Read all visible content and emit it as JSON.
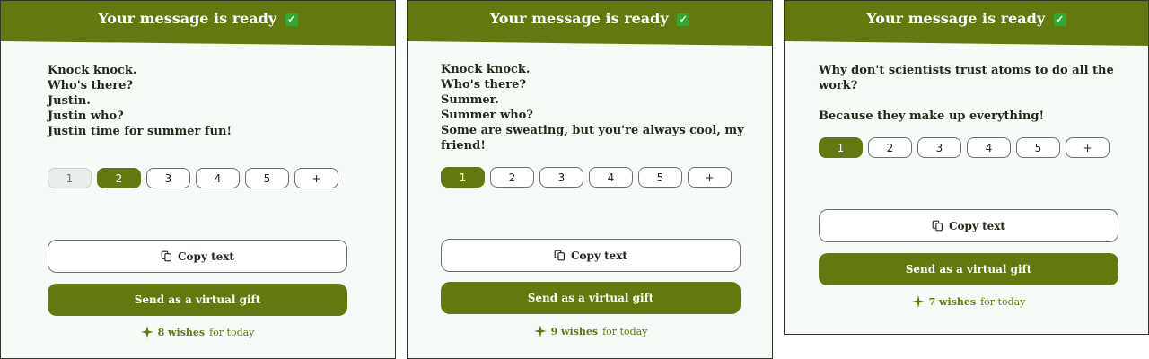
{
  "cards": [
    {
      "header_title": "Your message is ready",
      "header_check": "✓",
      "message_lines": [
        "Knock knock.",
        "Who's there?",
        "Justin.",
        "Justin who?",
        "Justin time for summer fun!"
      ],
      "pager": {
        "pages": [
          "1",
          "2",
          "3",
          "4",
          "5"
        ],
        "add_label": "+",
        "selected": "2",
        "visited": [
          "1"
        ]
      },
      "copy_label": "Copy text",
      "gift_label": "Send as a virtual gift",
      "wishes_count": "8 wishes",
      "wishes_suffix": "for today"
    },
    {
      "header_title": "Your message is ready",
      "header_check": "✓",
      "message_lines": [
        "Knock knock.",
        "Who's there?",
        "Summer.",
        "Summer who?",
        "Some are sweating, but you're always cool, my friend!"
      ],
      "pager": {
        "pages": [
          "1",
          "2",
          "3",
          "4",
          "5"
        ],
        "add_label": "+",
        "selected": "1",
        "visited": []
      },
      "copy_label": "Copy text",
      "gift_label": "Send as a virtual gift",
      "wishes_count": "9 wishes",
      "wishes_suffix": "for today"
    },
    {
      "header_title": "Your message is ready",
      "header_check": "✓",
      "message_lines": [
        "Why don't scientists trust atoms to do all the work?",
        "",
        "Because they make up everything!"
      ],
      "pager": {
        "pages": [
          "1",
          "2",
          "3",
          "4",
          "5"
        ],
        "add_label": "+",
        "selected": "1",
        "visited": []
      },
      "copy_label": "Copy text",
      "gift_label": "Send as a virtual gift",
      "wishes_count": "7 wishes",
      "wishes_suffix": "for today"
    }
  ],
  "colors": {
    "accent": "#63780e",
    "check_badge": "#2fa82f"
  },
  "icons": {
    "copy": "copy-icon",
    "sparkle": "sparkle-icon",
    "check": "check-icon"
  }
}
